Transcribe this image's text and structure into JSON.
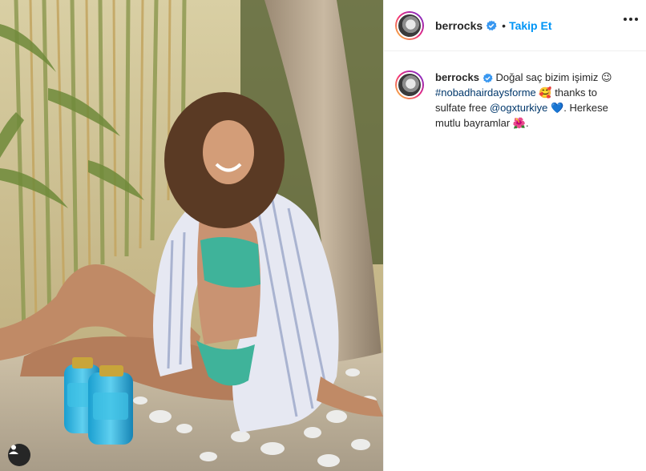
{
  "post": {
    "username": "berrocks",
    "verified": true,
    "separator": "•",
    "follow_label": "Takip Et"
  },
  "caption": {
    "username": "berrocks",
    "text_1": "Doğal saç bizim işimiz",
    "emoji_1": "😉",
    "hashtag": "#nobadhairdaysforme",
    "emoji_2": "🥰",
    "text_2": "thanks to sulfate free",
    "mention": "@ogxturkiye",
    "emoji_3": "💙",
    "text_3": ". Herkese mutlu bayramlar",
    "emoji_4": "🌺",
    "text_4": "."
  },
  "icons": {
    "verified": "verified-badge-icon",
    "more": "more-options-icon",
    "user_tag": "user-tag-icon"
  },
  "colors": {
    "accent_blue": "#0095f6",
    "link_blue": "#00376b",
    "text": "#262626"
  }
}
